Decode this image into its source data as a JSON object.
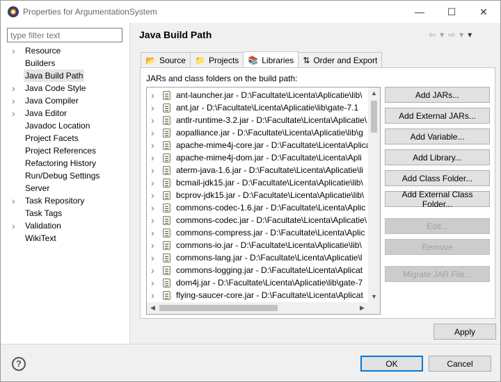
{
  "window": {
    "title": "Properties for ArgumentationSystem",
    "minimize": "—",
    "maximize": "☐",
    "close": "✕"
  },
  "filter": {
    "placeholder": "type filter text"
  },
  "tree": [
    {
      "label": "Resource",
      "expandable": true
    },
    {
      "label": "Builders",
      "expandable": false
    },
    {
      "label": "Java Build Path",
      "expandable": false,
      "selected": true
    },
    {
      "label": "Java Code Style",
      "expandable": true
    },
    {
      "label": "Java Compiler",
      "expandable": true
    },
    {
      "label": "Java Editor",
      "expandable": true
    },
    {
      "label": "Javadoc Location",
      "expandable": false
    },
    {
      "label": "Project Facets",
      "expandable": false
    },
    {
      "label": "Project References",
      "expandable": false
    },
    {
      "label": "Refactoring History",
      "expandable": false
    },
    {
      "label": "Run/Debug Settings",
      "expandable": false
    },
    {
      "label": "Server",
      "expandable": false
    },
    {
      "label": "Task Repository",
      "expandable": true
    },
    {
      "label": "Task Tags",
      "expandable": false
    },
    {
      "label": "Validation",
      "expandable": true
    },
    {
      "label": "WikiText",
      "expandable": false
    }
  ],
  "page": {
    "title": "Java Build Path"
  },
  "tabs": [
    {
      "label": "Source",
      "icon": "source-folder-icon",
      "glyph": "📂"
    },
    {
      "label": "Projects",
      "icon": "projects-folder-icon",
      "glyph": "📁"
    },
    {
      "label": "Libraries",
      "icon": "libraries-icon",
      "glyph": "📚",
      "active": true
    },
    {
      "label": "Order and Export",
      "icon": "order-export-icon",
      "glyph": "⇅"
    }
  ],
  "libraries": {
    "label": "JARs and class folders on the build path:",
    "jars": [
      "ant-launcher.jar - D:\\Facultate\\Licenta\\Aplicatie\\lib\\",
      "ant.jar - D:\\Facultate\\Licenta\\Aplicatie\\lib\\gate-7.1",
      "antlr-runtime-3.2.jar - D:\\Facultate\\Licenta\\Aplicatie\\",
      "aopalliance.jar - D:\\Facultate\\Licenta\\Aplicatie\\lib\\g",
      "apache-mime4j-core.jar - D:\\Facultate\\Licenta\\Aplica",
      "apache-mime4j-dom.jar - D:\\Facultate\\Licenta\\Apli",
      "aterm-java-1.6.jar - D:\\Facultate\\Licenta\\Aplicatie\\li",
      "bcmail-jdk15.jar - D:\\Facultate\\Licenta\\Aplicatie\\lib\\",
      "bcprov-jdk15.jar - D:\\Facultate\\Licenta\\Aplicatie\\lib\\",
      "commons-codec-1.6.jar - D:\\Facultate\\Licenta\\Aplic",
      "commons-codec.jar - D:\\Facultate\\Licenta\\Aplicatie\\",
      "commons-compress.jar - D:\\Facultate\\Licenta\\Aplic",
      "commons-io.jar - D:\\Facultate\\Licenta\\Aplicatie\\lib\\",
      "commons-lang.jar - D:\\Facultate\\Licenta\\Aplicatie\\l",
      "commons-logging.jar - D:\\Facultate\\Licenta\\Aplicat",
      "dom4j.jar - D:\\Facultate\\Licenta\\Aplicatie\\lib\\gate-7",
      "flying-saucer-core.jar - D:\\Facultate\\Licenta\\Aplicat"
    ]
  },
  "buttons": {
    "add_jars": "Add JARs...",
    "add_external_jars": "Add External JARs...",
    "add_variable": "Add Variable...",
    "add_library": "Add Library...",
    "add_class_folder": "Add Class Folder...",
    "add_external_class_folder": "Add External Class Folder...",
    "edit": "Edit...",
    "remove": "Remove",
    "migrate_jar": "Migrate JAR File...",
    "apply": "Apply",
    "ok": "OK",
    "cancel": "Cancel"
  },
  "help": {
    "glyph": "?"
  }
}
